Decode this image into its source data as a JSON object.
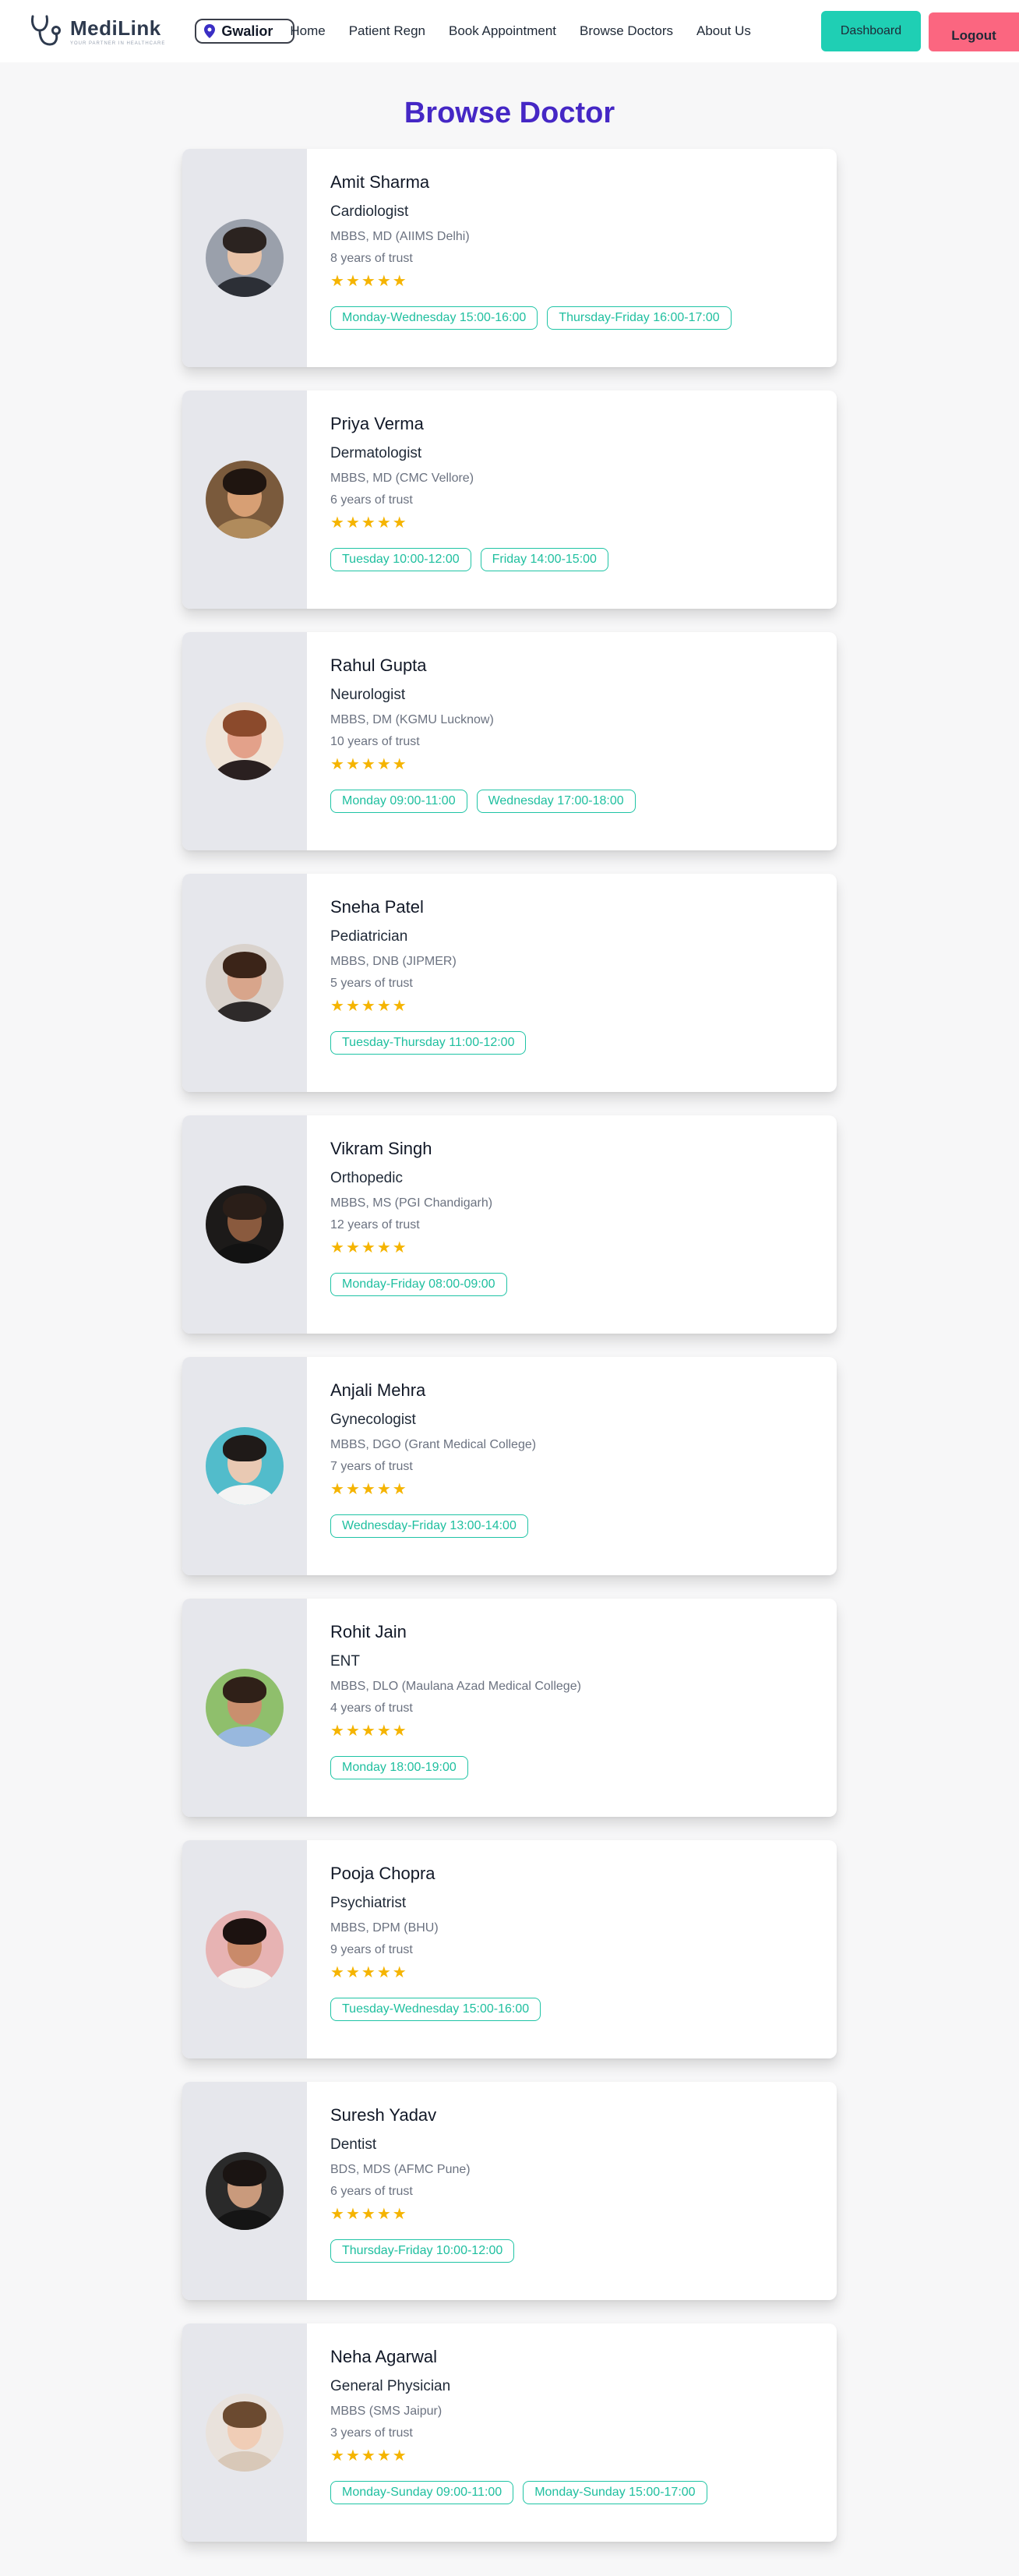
{
  "header": {
    "logo_name": "MediLink",
    "logo_tagline": "YOUR PARTNER IN HEALTHCARE",
    "location": "Gwalior",
    "nav": [
      "Home",
      "Patient Regn",
      "Book Appointment",
      "Browse Doctors",
      "About Us"
    ],
    "dashboard_label": "Dashboard",
    "logout_label": "Logout"
  },
  "page": {
    "title": "Browse Doctor"
  },
  "colors": {
    "title": "#4527c5",
    "accent": "#1fcfb4",
    "logout": "#fb6680",
    "star": "#f5b400",
    "slot_border": "#1fc4a5"
  },
  "doctors": [
    {
      "name": "Amit Sharma",
      "specialty": "Cardiologist",
      "qualification": "MBBS, MD (AIIMS Delhi)",
      "experience": "8 years of trust",
      "rating": 5,
      "slots": [
        "Monday-Wednesday 15:00-16:00",
        "Thursday-Friday 16:00-17:00"
      ],
      "avatar": {
        "bg": "#9aa0ab",
        "skin": "#e8c3a8",
        "hair": "#2b2320",
        "shirt": "#2c2f36"
      }
    },
    {
      "name": "Priya Verma",
      "specialty": "Dermatologist",
      "qualification": "MBBS, MD (CMC Vellore)",
      "experience": "6 years of trust",
      "rating": 5,
      "slots": [
        "Tuesday 10:00-12:00",
        "Friday 14:00-15:00"
      ],
      "avatar": {
        "bg": "#7a5a3c",
        "skin": "#d79f74",
        "hair": "#1f1510",
        "shirt": "#b08b5c"
      }
    },
    {
      "name": "Rahul Gupta",
      "specialty": "Neurologist",
      "qualification": "MBBS, DM (KGMU Lucknow)",
      "experience": "10 years of trust",
      "rating": 5,
      "slots": [
        "Monday 09:00-11:00",
        "Wednesday 17:00-18:00"
      ],
      "avatar": {
        "bg": "#efe4d8",
        "skin": "#e3a18a",
        "hair": "#8b4a2c",
        "shirt": "#2a2020"
      }
    },
    {
      "name": "Sneha Patel",
      "specialty": "Pediatrician",
      "qualification": "MBBS, DNB (JIPMER)",
      "experience": "5 years of trust",
      "rating": 5,
      "slots": [
        "Tuesday-Thursday 11:00-12:00"
      ],
      "avatar": {
        "bg": "#d9d2cc",
        "skin": "#d8a58b",
        "hair": "#3b2418",
        "shirt": "#2e2a2a"
      }
    },
    {
      "name": "Vikram Singh",
      "specialty": "Orthopedic",
      "qualification": "MBBS, MS (PGI Chandigarh)",
      "experience": "12 years of trust",
      "rating": 5,
      "slots": [
        "Monday-Friday 08:00-09:00"
      ],
      "avatar": {
        "bg": "#1c1a19",
        "skin": "#8a5a3e",
        "hair": "#2a1e18",
        "shirt": "#121212"
      }
    },
    {
      "name": "Anjali Mehra",
      "specialty": "Gynecologist",
      "qualification": "MBBS, DGO (Grant Medical College)",
      "experience": "7 years of trust",
      "rating": 5,
      "slots": [
        "Wednesday-Friday 13:00-14:00"
      ],
      "avatar": {
        "bg": "#52bccb",
        "skin": "#e9c9b3",
        "hair": "#1f1a18",
        "shirt": "#f4f4f4"
      }
    },
    {
      "name": "Rohit Jain",
      "specialty": "ENT",
      "qualification": "MBBS, DLO (Maulana Azad Medical College)",
      "experience": "4 years of trust",
      "rating": 5,
      "slots": [
        "Monday 18:00-19:00"
      ],
      "avatar": {
        "bg": "#8fbf6c",
        "skin": "#c98f6e",
        "hair": "#2f2018",
        "shirt": "#98b8de"
      }
    },
    {
      "name": "Pooja Chopra",
      "specialty": "Psychiatrist",
      "qualification": "MBBS, DPM (BHU)",
      "experience": "9 years of trust",
      "rating": 5,
      "slots": [
        "Tuesday-Wednesday 15:00-16:00"
      ],
      "avatar": {
        "bg": "#e7b3b3",
        "skin": "#c98a6a",
        "hair": "#1c1210",
        "shirt": "#f2f2f2"
      }
    },
    {
      "name": "Suresh Yadav",
      "specialty": "Dentist",
      "qualification": "BDS, MDS (AFMC Pune)",
      "experience": "6 years of trust",
      "rating": 5,
      "slots": [
        "Thursday-Friday 10:00-12:00"
      ],
      "avatar": {
        "bg": "#2a2a2a",
        "skin": "#c99a7c",
        "hair": "#1a1412",
        "shirt": "#151515"
      }
    },
    {
      "name": "Neha Agarwal",
      "specialty": "General Physician",
      "qualification": "MBBS (SMS Jaipur)",
      "experience": "3 years of trust",
      "rating": 5,
      "slots": [
        "Monday-Sunday 09:00-11:00",
        "Monday-Sunday 15:00-17:00"
      ],
      "avatar": {
        "bg": "#e9e2dc",
        "skin": "#f0cdb6",
        "hair": "#6b4a30",
        "shirt": "#d8c8b8"
      }
    }
  ]
}
